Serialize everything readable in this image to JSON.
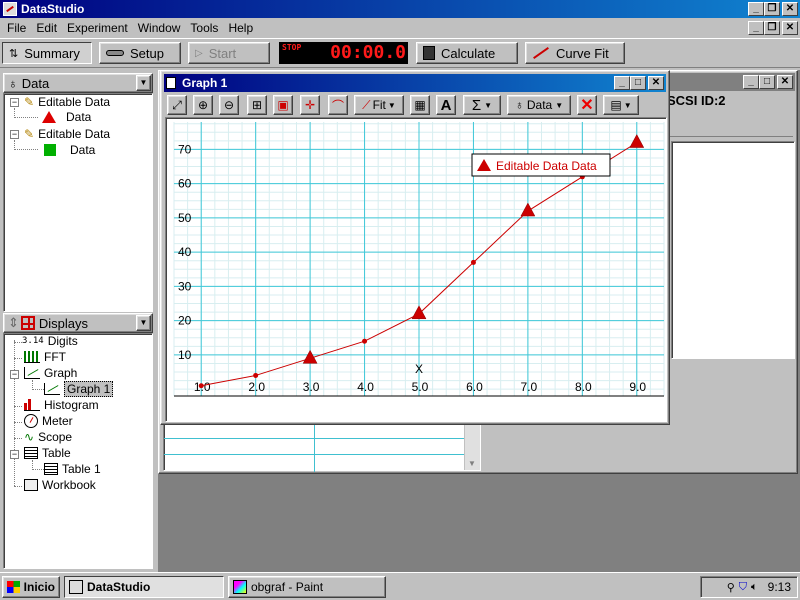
{
  "app": {
    "title": "DataStudio"
  },
  "menu": [
    "File",
    "Edit",
    "Experiment",
    "Window",
    "Tools",
    "Help"
  ],
  "toolbar": {
    "summary": "Summary",
    "setup": "Setup",
    "start": "Start",
    "stop_label": "STOP",
    "timer": "00:00.0",
    "calculate": "Calculate",
    "curve_fit": "Curve Fit"
  },
  "data_panel": {
    "header": "Data",
    "items": [
      {
        "label": "Editable Data",
        "child": "Data",
        "marker": "red-triangle"
      },
      {
        "label": "Editable Data",
        "child": "Data",
        "marker": "green-square"
      }
    ]
  },
  "displays_panel": {
    "header": "Displays",
    "items": [
      {
        "label": "Digits",
        "icon": "digits-icon"
      },
      {
        "label": "FFT",
        "icon": "fft-icon"
      },
      {
        "label": "Graph",
        "icon": "graph-icon",
        "child": "Graph 1"
      },
      {
        "label": "Histogram",
        "icon": "histogram-icon"
      },
      {
        "label": "Meter",
        "icon": "meter-icon"
      },
      {
        "label": "Scope",
        "icon": "scope-icon"
      },
      {
        "label": "Table",
        "icon": "table-icon",
        "child": "Table 1"
      },
      {
        "label": "Workbook",
        "icon": "workbook-icon"
      }
    ]
  },
  "background_window": {
    "visible_text": "SCSI ID:2"
  },
  "graph_window": {
    "title": "Graph 1",
    "toolbar": {
      "fit": "Fit",
      "data": "Data",
      "sigma": "Σ",
      "text": "A"
    },
    "legend": "Editable Data Data",
    "x_axis_label": "X"
  },
  "chart_data": {
    "type": "line",
    "x_ticks": [
      "1.0",
      "2.0",
      "3.0",
      "4.0",
      "5.0",
      "6.0",
      "7.0",
      "8.0",
      "9.0"
    ],
    "y_ticks": [
      "10",
      "20",
      "30",
      "40",
      "50",
      "60",
      "70"
    ],
    "xlim": [
      0.5,
      9.5
    ],
    "ylim": [
      -2,
      78
    ],
    "xlabel": "X",
    "grid": true,
    "legend_position": "top-right",
    "series": [
      {
        "name": "Editable Data Data",
        "color": "#cc0000",
        "x": [
          1,
          2,
          3,
          4,
          5,
          6,
          7,
          8,
          9
        ],
        "y": [
          1,
          4,
          9,
          14,
          22,
          37,
          52,
          62,
          72
        ],
        "triangle_markers_at": [
          3,
          5,
          7,
          9
        ]
      }
    ]
  },
  "taskbar": {
    "start": "Inicio",
    "tasks": [
      "DataStudio",
      "obgraf - Paint"
    ],
    "clock": "9:13"
  }
}
